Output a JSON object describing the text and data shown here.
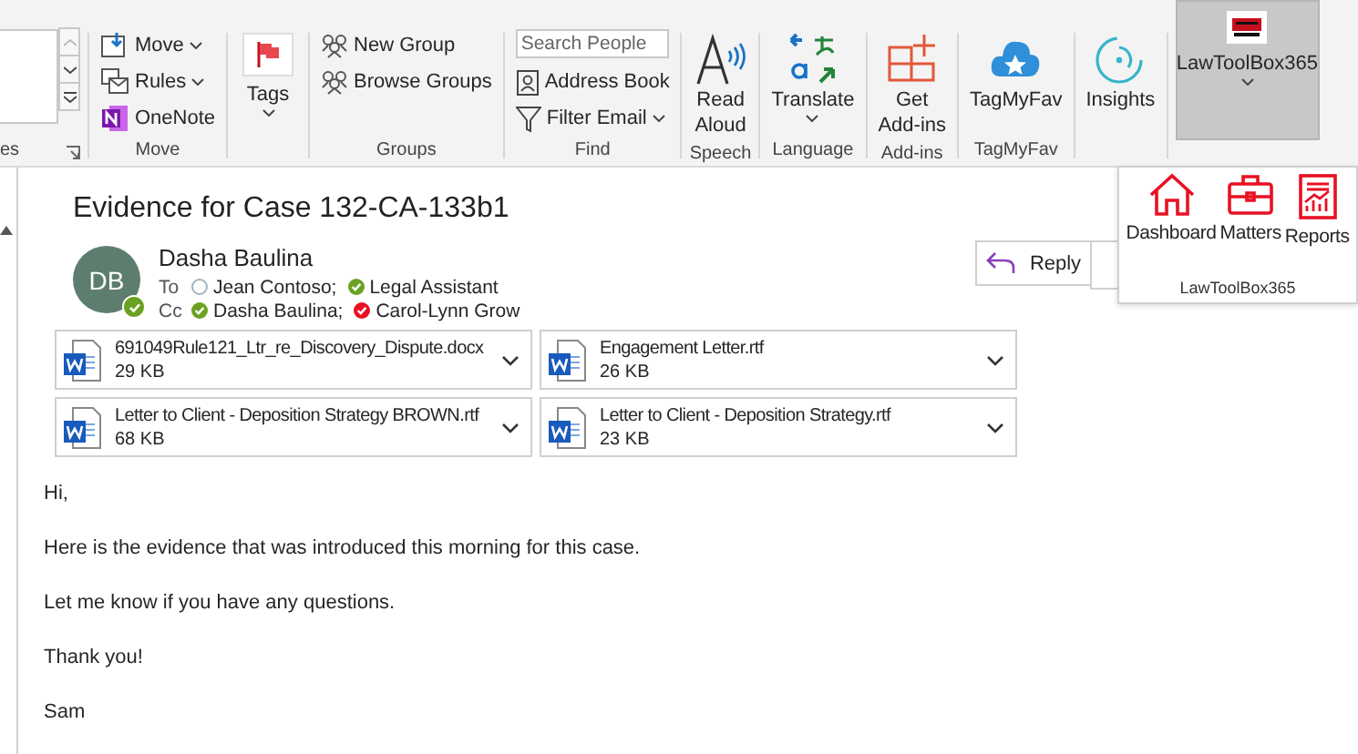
{
  "ribbon": {
    "cut_group_label": "es",
    "move_group": {
      "label": "Move",
      "items": [
        {
          "kind": "move",
          "label": "Move",
          "dropdown": true
        },
        {
          "kind": "rules",
          "label": "Rules",
          "dropdown": true
        },
        {
          "kind": "onenote",
          "label": "OneNote",
          "dropdown": false
        }
      ]
    },
    "tags_group": {
      "label": "Tags",
      "dropdown": true
    },
    "groups_group": {
      "label": "Groups",
      "items": [
        "New Group",
        "Browse Groups"
      ]
    },
    "find_group": {
      "label": "Find",
      "search": {
        "placeholder": "Search People"
      },
      "items": [
        {
          "kind": "book",
          "label": "Address Book",
          "dropdown": false
        },
        {
          "kind": "filter",
          "label": "Filter Email",
          "dropdown": true
        }
      ]
    },
    "big_buttons": [
      {
        "kind": "read",
        "lines": [
          "Read",
          "Aloud"
        ],
        "dropdown": false,
        "group_label": "Speech",
        "selected": false
      },
      {
        "kind": "translate",
        "lines": [
          "Translate"
        ],
        "dropdown": true,
        "group_label": "Language",
        "selected": false
      },
      {
        "kind": "addins",
        "lines": [
          "Get",
          "Add-ins"
        ],
        "dropdown": false,
        "group_label": "Add-ins",
        "selected": false
      },
      {
        "kind": "cloud",
        "lines": [
          "TagMyFav"
        ],
        "dropdown": false,
        "group_label": "TagMyFav",
        "selected": false
      },
      {
        "kind": "insights",
        "lines": [
          "Insights"
        ],
        "dropdown": false,
        "selected": false
      },
      {
        "kind": "logo",
        "lines": [
          "LawToolBox365"
        ],
        "dropdown": true,
        "selected": true
      }
    ]
  },
  "popup": {
    "items": [
      {
        "kind": "home",
        "label": "Dashboard"
      },
      {
        "kind": "briefcase",
        "label": "Matters"
      },
      {
        "kind": "report",
        "label": "Reports"
      }
    ],
    "footer": "LawToolBox365"
  },
  "message": {
    "subject": "Evidence for Case 132-CA-133b1",
    "sender": {
      "initials": "DB",
      "name": "Dasha Baulina",
      "color": "#6aa121"
    },
    "to": {
      "label": "To",
      "recipients": [
        {
          "name": "Jean Contoso;"
        },
        {
          "name": "Legal Assistant",
          "color": "#6aa121"
        }
      ]
    },
    "cc": {
      "label": "Cc",
      "recipients": [
        {
          "name": "Dasha Baulina;",
          "color": "#6aa121"
        },
        {
          "name": "Carol-Lynn Grow",
          "color": "#e81123"
        }
      ]
    },
    "reply": "Reply",
    "attachments": [
      {
        "name": "691049Rule121_Ltr_re_Discovery_Dispute.docx",
        "size": "29 KB"
      },
      {
        "name": "Engagement Letter.rtf",
        "size": "26 KB"
      },
      {
        "name": "Letter to Client - Deposition Strategy BROWN.rtf",
        "size": "68 KB"
      },
      {
        "name": "Letter to Client - Deposition Strategy.rtf",
        "size": "23 KB"
      }
    ],
    "body": [
      "Hi,",
      "Here is the evidence that was introduced this morning for this case.",
      "Let me know if you have any questions.",
      "Thank you!",
      "Sam"
    ]
  }
}
